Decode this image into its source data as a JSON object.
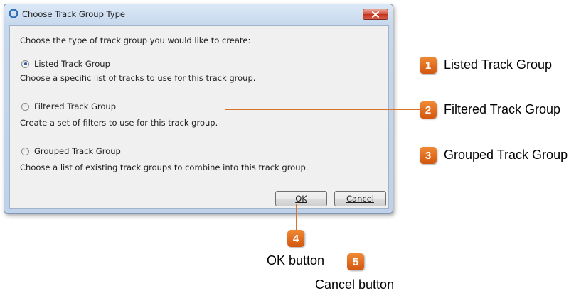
{
  "dialog": {
    "title": "Choose Track Group Type",
    "close_icon": "close-x-icon",
    "prompt": "Choose the type of track group you would like to create:",
    "options": [
      {
        "label": "Listed Track Group",
        "description": "Choose a specific list of tracks to use for this track group.",
        "checked": true
      },
      {
        "label": "Filtered Track Group",
        "description": "Create a set of filters to use for this track group.",
        "checked": false
      },
      {
        "label": "Grouped Track Group",
        "description": "Choose a list of existing track groups to combine into this track group.",
        "checked": false
      }
    ],
    "ok_label": "OK",
    "cancel_label": "Cancel"
  },
  "callouts": [
    {
      "number": "1",
      "text": "Listed Track Group"
    },
    {
      "number": "2",
      "text": "Filtered Track Group"
    },
    {
      "number": "3",
      "text": "Grouped Track Group"
    },
    {
      "number": "4",
      "text": "OK button"
    },
    {
      "number": "5",
      "text": "Cancel button"
    }
  ],
  "colors": {
    "callout_accent": "#d9742b",
    "badge": "#e8701f"
  }
}
